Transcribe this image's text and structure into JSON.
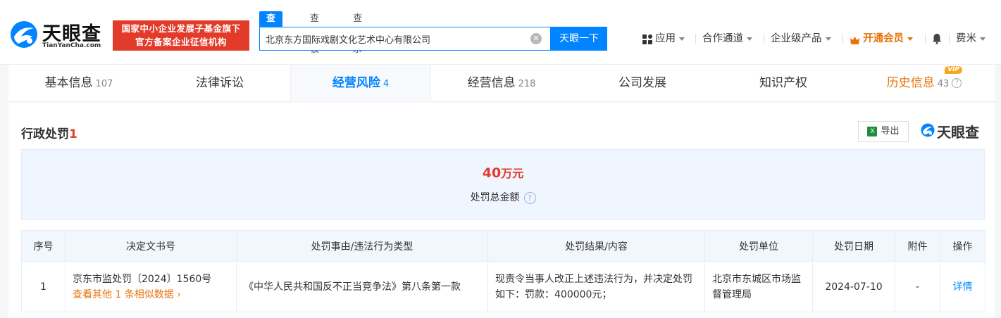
{
  "header": {
    "logo_cn": "天眼查",
    "logo_en": "TianYanCha.com",
    "banner_line1": "国家中小企业发展子基金旗下",
    "banner_line2": "官方备案企业征信机构",
    "search_tabs": [
      "查公司",
      "查老板",
      "查关系"
    ],
    "search_value": "北京东方国际戏剧文化艺术中心有限公司",
    "search_button": "天眼一下",
    "nav": {
      "apps": "应用",
      "partner": "合作通道",
      "enterprise": "企业级产品",
      "vip": "开通会员",
      "user": "费米"
    }
  },
  "tabs": [
    {
      "label": "基本信息",
      "count": "107"
    },
    {
      "label": "法律诉讼",
      "count": ""
    },
    {
      "label": "经营风险",
      "count": "4"
    },
    {
      "label": "经营信息",
      "count": "218"
    },
    {
      "label": "公司发展",
      "count": ""
    },
    {
      "label": "知识产权",
      "count": ""
    },
    {
      "label": "历史信息",
      "count": "43",
      "badge": "VIP"
    }
  ],
  "section": {
    "title": "行政处罚",
    "count": "1",
    "export_label": "导出",
    "watermark": "天眼查",
    "summary_value": "40",
    "summary_unit": "万元",
    "summary_label": "处罚总金额"
  },
  "table": {
    "headers": [
      "序号",
      "决定文书号",
      "处罚事由/违法行为类型",
      "处罚结果/内容",
      "处罚单位",
      "处罚日期",
      "附件",
      "操作"
    ],
    "rows": [
      {
        "index": "1",
        "doc_no": "京东市监处罚〔2024〕1560号",
        "similar": "查看其他 1 条相似数据",
        "reason": "《中华人民共和国反不正当竞争法》第八条第一款",
        "result": "现责令当事人改正上述违法行为，并决定处罚如下：罚款：400000元；",
        "authority": "北京市东城区市场监督管理局",
        "date": "2024-07-10",
        "attachment": "-",
        "action": "详情"
      }
    ]
  },
  "colors": {
    "brand_blue": "#0084ff",
    "accent_red": "#e33b2a",
    "vip_orange": "#e6730b"
  }
}
